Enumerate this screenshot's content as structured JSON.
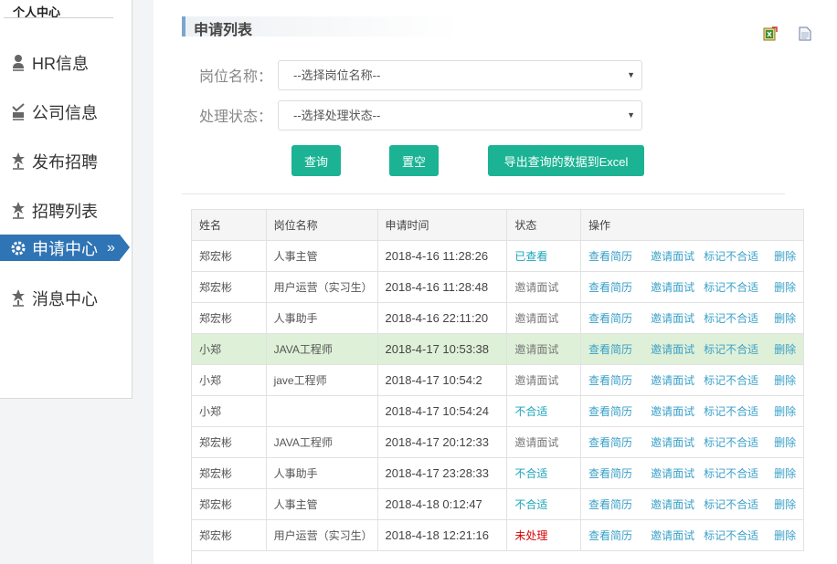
{
  "sidebar": {
    "title": "个人中心",
    "items": [
      {
        "label": "HR信息",
        "icon": "user-icon"
      },
      {
        "label": "公司信息",
        "icon": "checklist-icon"
      },
      {
        "label": "发布招聘",
        "icon": "star-pin-icon"
      },
      {
        "label": "招聘列表",
        "icon": "star-pin-icon"
      },
      {
        "label": "申请中心",
        "icon": "gear-icon",
        "active": true,
        "chevron": "»"
      },
      {
        "label": "消息中心",
        "icon": "star-pin-icon"
      }
    ]
  },
  "header": {
    "title": "申请列表",
    "tools": [
      "excel-export-icon",
      "document-icon"
    ]
  },
  "form": {
    "position_label": "岗位名称：",
    "position_placeholder": "--选择岗位名称--",
    "status_label": "处理状态：",
    "status_placeholder": "--选择处理状态--",
    "query_button": "查询",
    "reset_button": "置空",
    "export_button": "导出查询的数据到Excel"
  },
  "table": {
    "columns": [
      "姓名",
      "岗位名称",
      "申请时间",
      "状态",
      "操作"
    ],
    "actions": [
      "查看简历",
      "邀请面试",
      "标记不合适",
      "删除"
    ],
    "rows": [
      {
        "name": "郑宏彬",
        "position": "人事主管",
        "time": "2018-4-16 11:28:26",
        "status": "已查看",
        "status_type": "viewed"
      },
      {
        "name": "郑宏彬",
        "position": "用户运营（实习生）",
        "time": "2018-4-16 11:28:48",
        "status": "邀请面试",
        "status_type": "invite"
      },
      {
        "name": "郑宏彬",
        "position": "人事助手",
        "time": "2018-4-16 22:11:20",
        "status": "邀请面试",
        "status_type": "invite"
      },
      {
        "name": "小郑",
        "position": "JAVA工程师",
        "time": "2018-4-17 10:53:38",
        "status": "邀请面试",
        "status_type": "invite",
        "highlight": true
      },
      {
        "name": "小郑",
        "position": "jave工程师",
        "time": "2018-4-17 10:54:2",
        "status": "邀请面试",
        "status_type": "invite"
      },
      {
        "name": "小郑",
        "position": "",
        "time": "2018-4-17 10:54:24",
        "status": "不合适",
        "status_type": "reject"
      },
      {
        "name": "郑宏彬",
        "position": "JAVA工程师",
        "time": "2018-4-17 20:12:33",
        "status": "邀请面试",
        "status_type": "invite"
      },
      {
        "name": "郑宏彬",
        "position": "人事助手",
        "time": "2018-4-17 23:28:33",
        "status": "不合适",
        "status_type": "reject"
      },
      {
        "name": "郑宏彬",
        "position": "人事主管",
        "time": "2018-4-18 0:12:47",
        "status": "不合适",
        "status_type": "reject"
      },
      {
        "name": "郑宏彬",
        "position": "用户运营（实习生）",
        "time": "2018-4-18 12:21:16",
        "status": "未处理",
        "status_type": "pending"
      }
    ]
  },
  "colors": {
    "accent_green": "#1bb394",
    "nav_active": "#2f74b5",
    "link": "#3aa0c8",
    "status_pending": "#d90000",
    "row_highlight": "#dff0d8"
  }
}
